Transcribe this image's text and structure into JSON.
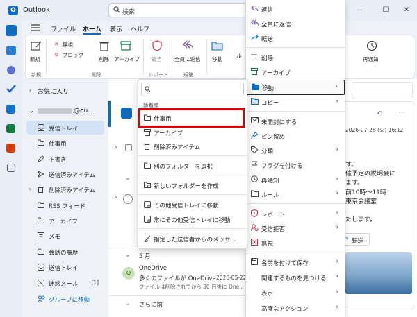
{
  "app": {
    "title": "Outlook",
    "logo": "O"
  },
  "search": {
    "placeholder": "検索"
  },
  "window_controls": {
    "minimize": "—",
    "maximize": "☐",
    "close": "✕"
  },
  "ribbon": {
    "tabs": [
      "ファイル",
      "ホーム",
      "表示",
      "ヘルプ"
    ],
    "buttons": {
      "new": "新規",
      "ignore": "無視",
      "block": "ブロック",
      "delete": "削除",
      "archive": "アーカイブ",
      "report": "報告",
      "reply_all": "全員に返信",
      "move": "移動",
      "rule": "ル",
      "remind": "再通知"
    },
    "groups": [
      "新規",
      "削除",
      "レポート",
      "返答"
    ]
  },
  "folders": {
    "favorites": "お気に入り",
    "account": "@ou...",
    "items": [
      {
        "label": "受信トレイ",
        "icon": "inbox-icon"
      },
      {
        "label": "仕事用",
        "icon": "folder-icon"
      },
      {
        "label": "下書き",
        "icon": "draft-icon"
      },
      {
        "label": "送信済みアイテム",
        "icon": "sent-icon"
      },
      {
        "label": "削除済みアイテム",
        "icon": "trash-icon"
      },
      {
        "label": "RSS フィード",
        "icon": "folder-icon"
      },
      {
        "label": "アーカイブ",
        "icon": "folder-icon"
      },
      {
        "label": "メモ",
        "icon": "note-icon"
      },
      {
        "label": "会話の履歴",
        "icon": "folder-icon"
      },
      {
        "label": "送信トレイ",
        "icon": "outbox-icon"
      },
      {
        "label": "迷惑メール",
        "icon": "junk-icon",
        "count": "[1]"
      },
      {
        "label": "グループに移動",
        "icon": "group-icon"
      }
    ]
  },
  "messages": {
    "section_may": "5 月",
    "section_earlier": "さらに前",
    "onedrive": {
      "avatar": "O",
      "sender": "OneDrive",
      "subject": "多くのファイルが OneDrive...",
      "date": "2026-05-22",
      "preview": "ファイルは削除されてから 30 日後に One..."
    }
  },
  "reading": {
    "date": "2026-07-28 (火) 16:12",
    "lines": [
      "す。",
      "催予定の説明会に",
      "ます。",
      "前10時～11時",
      "東京会議室",
      "たします。"
    ],
    "forward": "転送"
  },
  "move_submenu": {
    "recent_header": "新着順",
    "items": [
      {
        "label": "仕事用",
        "icon": "folder-icon"
      },
      {
        "label": "アーカイブ",
        "icon": "archive-icon"
      },
      {
        "label": "削除済みアイテム",
        "icon": "trash-icon"
      },
      {
        "label": "別のフォルダーを選択",
        "icon": "folder-select-icon"
      },
      {
        "label": "新しいフォルダーを作成",
        "icon": "folder-add-icon"
      },
      {
        "label": "その他受信トレイに移動",
        "icon": "move-other-icon"
      },
      {
        "label": "常にその他受信トレイに移動",
        "icon": "move-other-always-icon"
      },
      {
        "label": "指定した送信者からのメッセ...",
        "icon": "sweep-icon"
      }
    ]
  },
  "context_menu": {
    "items": [
      {
        "label": "返信",
        "icon": "reply-icon"
      },
      {
        "label": "全員に返信",
        "icon": "reply-all-icon"
      },
      {
        "label": "転送",
        "icon": "forward-icon"
      },
      {
        "label": "削除",
        "icon": "trash-icon"
      },
      {
        "label": "アーカイブ",
        "icon": "archive-icon"
      },
      {
        "label": "移動",
        "icon": "move-icon",
        "submenu": true
      },
      {
        "label": "コピー",
        "icon": "copy-icon",
        "submenu": true
      },
      {
        "label": "未開封にする",
        "icon": "mail-unread-icon"
      },
      {
        "label": "ピン留め",
        "icon": "pin-icon"
      },
      {
        "label": "分類",
        "icon": "tag-icon",
        "submenu": true
      },
      {
        "label": "フラグを付ける",
        "icon": "flag-icon"
      },
      {
        "label": "再通知",
        "icon": "clock-icon",
        "submenu": true
      },
      {
        "label": "ルール",
        "icon": "rule-icon",
        "submenu": true
      },
      {
        "label": "レポート",
        "icon": "report-icon",
        "submenu": true
      },
      {
        "label": "受信拒否",
        "icon": "block-icon",
        "submenu": true
      },
      {
        "label": "無視",
        "icon": "ignore-icon"
      },
      {
        "label": "名前を付けて保存",
        "icon": "save-icon",
        "submenu": true
      },
      {
        "label": "関連するものを見つける",
        "icon": "",
        "submenu": true
      },
      {
        "label": "表示",
        "icon": "",
        "submenu": true
      },
      {
        "label": "高度なアクション",
        "icon": "",
        "submenu": true
      }
    ]
  },
  "colors": {
    "accent": "#0f6cbd",
    "highlight": "#e00000",
    "danger": "#c4314b",
    "green": "#107c41"
  }
}
